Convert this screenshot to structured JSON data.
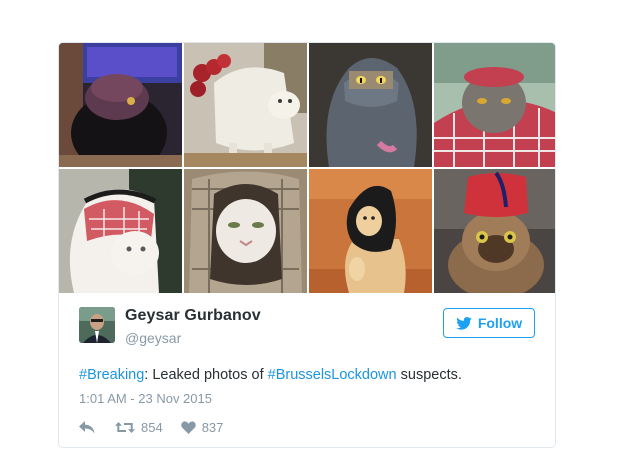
{
  "tweet": {
    "author": {
      "display_name": "Geysar Gurbanov",
      "handle": "@geysar"
    },
    "follow_label": "Follow",
    "text": {
      "hashtag_1": "#Breaking",
      "middle": ": Leaked photos of ",
      "hashtag_2": "#BrusselsLockdown",
      "end": " suspects."
    },
    "timestamp": "1:01 AM - 23 Nov 2015",
    "retweet_count": "854",
    "like_count": "837"
  },
  "colors": {
    "accent": "#1da1f2",
    "hashtag": "#1b95e0",
    "muted": "#8899a6",
    "text": "#292f33",
    "border": "#e1e8ed"
  },
  "icons": {
    "follow": "twitter-bird-icon",
    "reply": "reply-arrow-icon",
    "retweet": "retweet-icon",
    "like": "heart-icon"
  }
}
